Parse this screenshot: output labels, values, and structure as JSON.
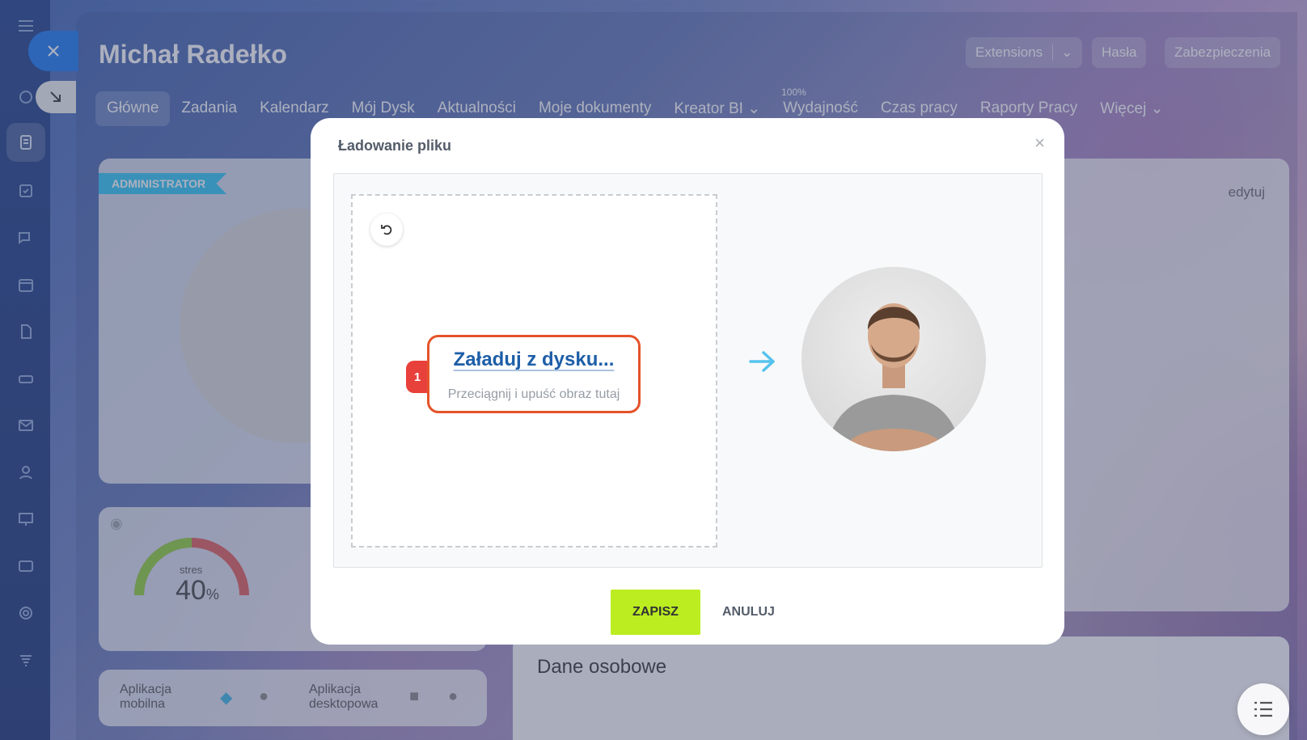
{
  "header": {
    "user_name": "Michał Radełko",
    "buttons": {
      "extensions": "Extensions",
      "passwords": "Hasła",
      "security": "Zabezpieczenia"
    }
  },
  "tabs": [
    {
      "label": "Główne"
    },
    {
      "label": "Zadania"
    },
    {
      "label": "Kalendarz"
    },
    {
      "label": "Mój Dysk"
    },
    {
      "label": "Aktualności"
    },
    {
      "label": "Moje dokumenty"
    },
    {
      "label": "Kreator BI"
    },
    {
      "label": "Wydajność",
      "badge": "100%"
    },
    {
      "label": "Czas pracy"
    },
    {
      "label": "Raporty Pracy"
    },
    {
      "label": "Więcej"
    }
  ],
  "profile": {
    "role_badge": "ADMINISTRATOR",
    "edit_link": "edytuj",
    "stress_label": "stres",
    "stress_value": "40",
    "stress_unit": "%",
    "section_title": "Dane osobowe",
    "apps": {
      "mobile": "Aplikacja mobilna",
      "desktop": "Aplikacja desktopowa"
    }
  },
  "modal": {
    "title": "Ładowanie pliku",
    "upload_link": "Załaduj z dysku...",
    "upload_hint": "Przeciągnij i upuść obraz tutaj",
    "marker_number": "1",
    "save_label": "ZAPISZ",
    "cancel_label": "ANULUJ",
    "close_glyph": "×"
  },
  "colors": {
    "primary_blue": "#1877f2",
    "save_green": "#bbed21",
    "highlight_orange": "#e4532a",
    "marker_red": "#e8403a"
  }
}
